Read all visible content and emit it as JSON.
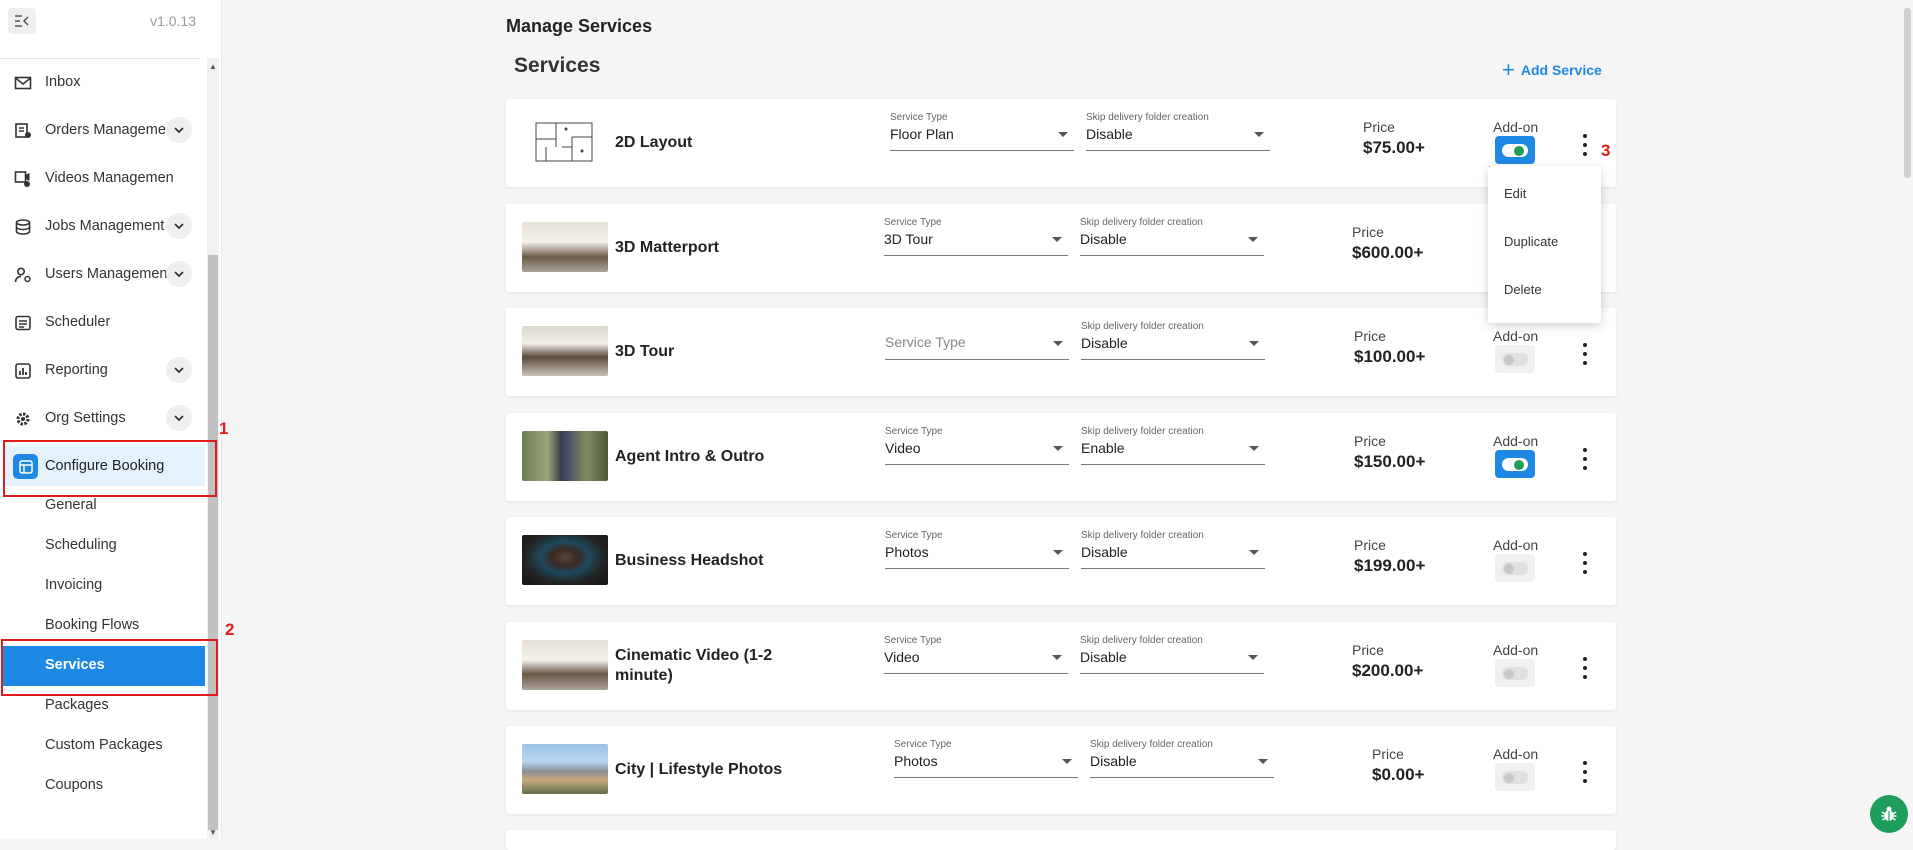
{
  "app": {
    "version": "v1.0.13"
  },
  "sidebar": {
    "items": [
      {
        "label": "Inbox",
        "icon": "inbox-icon"
      },
      {
        "label": "Orders Management",
        "icon": "orders-icon",
        "expandable": true
      },
      {
        "label": "Videos Management",
        "icon": "videos-icon"
      },
      {
        "label": "Jobs Management",
        "icon": "jobs-icon",
        "expandable": true
      },
      {
        "label": "Users Management",
        "icon": "users-icon",
        "expandable": true
      },
      {
        "label": "Scheduler",
        "icon": "scheduler-icon"
      },
      {
        "label": "Reporting",
        "icon": "reporting-icon",
        "expandable": true
      },
      {
        "label": "Org Settings",
        "icon": "gear-icon",
        "expandable": true
      },
      {
        "label": "Configure Booking",
        "icon": "booking-icon",
        "active": true
      }
    ],
    "sub_items": [
      {
        "label": "General"
      },
      {
        "label": "Scheduling"
      },
      {
        "label": "Invoicing"
      },
      {
        "label": "Booking Flows"
      },
      {
        "label": "Services",
        "active": true
      },
      {
        "label": "Packages"
      },
      {
        "label": "Custom Packages"
      },
      {
        "label": "Coupons"
      }
    ]
  },
  "annotations": {
    "step1": "1",
    "step2": "2",
    "step3": "3",
    "color": "#e01b1b"
  },
  "main": {
    "page_title": "Manage Services",
    "section_title": "Services",
    "add_service_label": "Add Service",
    "labels": {
      "service_type": "Service Type",
      "skip_delivery": "Skip delivery folder creation",
      "price": "Price",
      "addon": "Add-on"
    },
    "services": [
      {
        "name": "2D Layout",
        "service_type": "Floor Plan",
        "skip_delivery": "Disable",
        "price": "$75.00+",
        "addon": true
      },
      {
        "name": "3D Matterport",
        "service_type": "3D Tour",
        "skip_delivery": "Disable",
        "price": "$600.00+",
        "addon": null
      },
      {
        "name": "3D Tour",
        "service_type": "",
        "service_type_placeholder": "Service Type",
        "skip_delivery": "Disable",
        "price": "$100.00+",
        "addon": false
      },
      {
        "name": "Agent Intro & Outro",
        "service_type": "Video",
        "skip_delivery": "Enable",
        "price": "$150.00+",
        "addon": true
      },
      {
        "name": "Business Headshot",
        "service_type": "Photos",
        "skip_delivery": "Disable",
        "price": "$199.00+",
        "addon": false
      },
      {
        "name": "Cinematic Video (1-2 minute)",
        "service_type": "Video",
        "skip_delivery": "Disable",
        "price": "$200.00+",
        "addon": false
      },
      {
        "name": "City | Lifestyle Photos",
        "service_type": "Photos",
        "skip_delivery": "Disable",
        "price": "$0.00+",
        "addon": false
      }
    ],
    "context_menu": [
      "Edit",
      "Duplicate",
      "Delete"
    ]
  },
  "colors": {
    "accent": "#1e88e5",
    "toggle_knob_on": "#1e9e5a",
    "fab": "#1e9e5a"
  }
}
